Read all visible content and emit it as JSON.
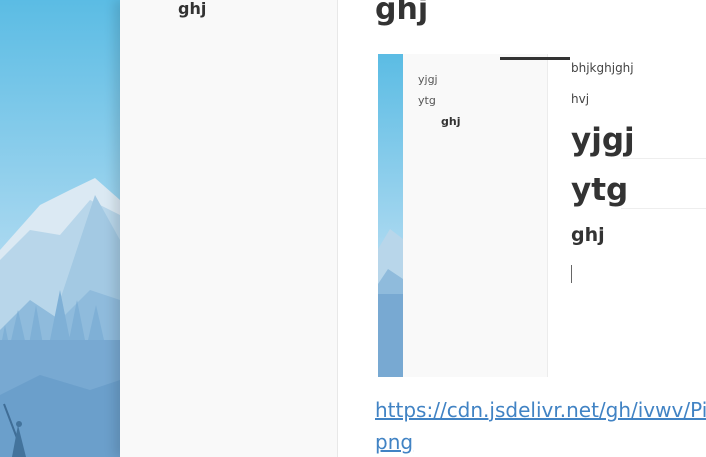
{
  "toc": {
    "items": [
      {
        "label": "ghj",
        "level": 3
      }
    ]
  },
  "content": {
    "heading": "ghj",
    "embedded_screenshot": {
      "toc_items": [
        {
          "label": "yjgj",
          "level": 1
        },
        {
          "label": "ytg",
          "level": 1
        },
        {
          "label": "ghj",
          "level": 3
        }
      ],
      "document": {
        "paragraph_1": "bhjkghjghj",
        "paragraph_2": "hvj",
        "heading_1a": "yjgj",
        "heading_1b": "ytg",
        "heading_3": "ghj"
      }
    },
    "link": {
      "line_1": "https://cdn.jsdelivr.net/gh/ivwv/PicG",
      "line_2": "png"
    }
  },
  "colors": {
    "text": "#333333",
    "link": "#4183c4",
    "sidebar_bg": "#f9f9f9",
    "sky_top": "#6ec3e6",
    "sky_bottom": "#c7e3f2",
    "mountains": "#a9cce6"
  }
}
